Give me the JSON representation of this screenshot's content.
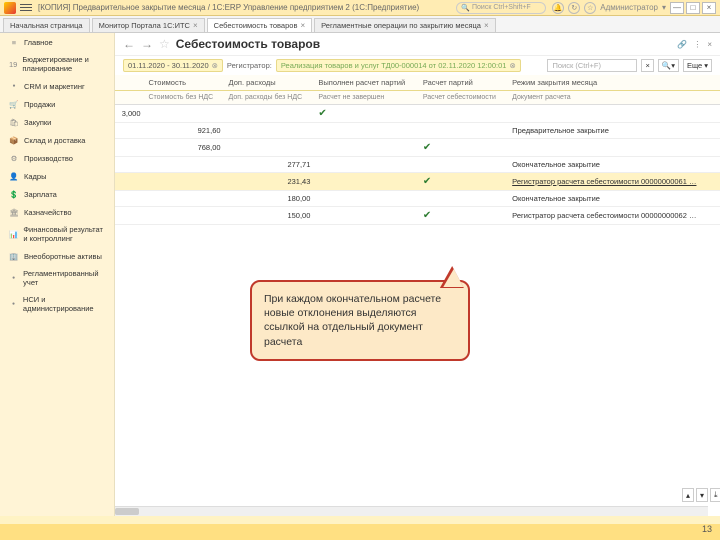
{
  "titlebar": {
    "title": "[КОПИЯ] Предварительное закрытие месяца / 1С:ERP Управление предприятием 2  (1С:Предприятие)",
    "search_placeholder": "Поиск Ctrl+Shift+F",
    "user": "Администратор"
  },
  "tabs": [
    {
      "label": "Начальная страница",
      "closable": false
    },
    {
      "label": "Монитор Портала 1С:ИТС",
      "closable": true
    },
    {
      "label": "Себестоимость товаров",
      "closable": true,
      "active": true
    },
    {
      "label": "Регламентные операции по закрытию месяца",
      "closable": true
    }
  ],
  "sidebar": [
    {
      "icon": "≡",
      "label": "Главное"
    },
    {
      "icon": "19",
      "label": "Бюджетирование и планирование"
    },
    {
      "icon": "•",
      "label": "CRM и маркетинг"
    },
    {
      "icon": "🛒",
      "label": "Продажи"
    },
    {
      "icon": "🛍",
      "label": "Закупки"
    },
    {
      "icon": "📦",
      "label": "Склад и доставка"
    },
    {
      "icon": "⚙",
      "label": "Производство"
    },
    {
      "icon": "👤",
      "label": "Кадры"
    },
    {
      "icon": "💲",
      "label": "Зарплата"
    },
    {
      "icon": "🏛",
      "label": "Казначейство"
    },
    {
      "icon": "📊",
      "label": "Финансовый результат и контроллинг"
    },
    {
      "icon": "🏢",
      "label": "Внеоборотные активы"
    },
    {
      "icon": "•",
      "label": "Регламентированный учет"
    },
    {
      "icon": "•",
      "label": "НСИ и администрирование"
    }
  ],
  "page": {
    "title": "Себестоимость товаров",
    "filters": {
      "period": "01.11.2020 - 30.11.2020",
      "reg_label": "Регистратор:",
      "reg_value": "Реализация товаров и услуг ТД00-000014 от 02.11.2020 12:00:01"
    },
    "search_placeholder": "Поиск (Ctrl+F)",
    "more_btn": "Еще"
  },
  "grid": {
    "headers1": [
      "",
      "Стоимость",
      "Доп. расходы",
      "Выполнен расчет партий",
      "Расчет партий",
      "Режим закрытия месяца"
    ],
    "headers2": [
      "",
      "Стоимость без НДС",
      "Доп. расходы без НДС",
      "Расчет не завершен",
      "Расчет себестоимости",
      "Документ расчета"
    ],
    "rows": [
      {
        "c1": "3,000",
        "c2": "",
        "c3": "",
        "tick_col": 3,
        "c5": "",
        "c6": ""
      },
      {
        "c1": "",
        "c2": "921,60",
        "c3": "",
        "tick_col": 0,
        "c5": "",
        "c6": "Предварительное закрытие"
      },
      {
        "c1": "",
        "c2": "768,00",
        "c3": "",
        "tick_col": 5,
        "c5": "",
        "c6": ""
      },
      {
        "c1": "",
        "c2": "",
        "c3": "277,71",
        "tick_col": 0,
        "c5": "",
        "c6": "Окончательное закрытие"
      },
      {
        "c1": "",
        "c2": "",
        "c3": "231,43",
        "tick_col": 5,
        "c5": "",
        "c6": "Регистратор расчета себестоимости 00000000061 …",
        "hl": true,
        "link": true
      },
      {
        "c1": "",
        "c2": "",
        "c3": "180,00",
        "tick_col": 0,
        "c5": "",
        "c6": "Окончательное закрытие"
      },
      {
        "c1": "",
        "c2": "",
        "c3": "150,00",
        "tick_col": 5,
        "c5": "",
        "c6": "Регистратор расчета себестоимости 00000000062 …"
      }
    ]
  },
  "callout": "При каждом окончательном расчете новые отклонения выделяются ссылкой на отдельный документ расчета",
  "page_num": "13"
}
